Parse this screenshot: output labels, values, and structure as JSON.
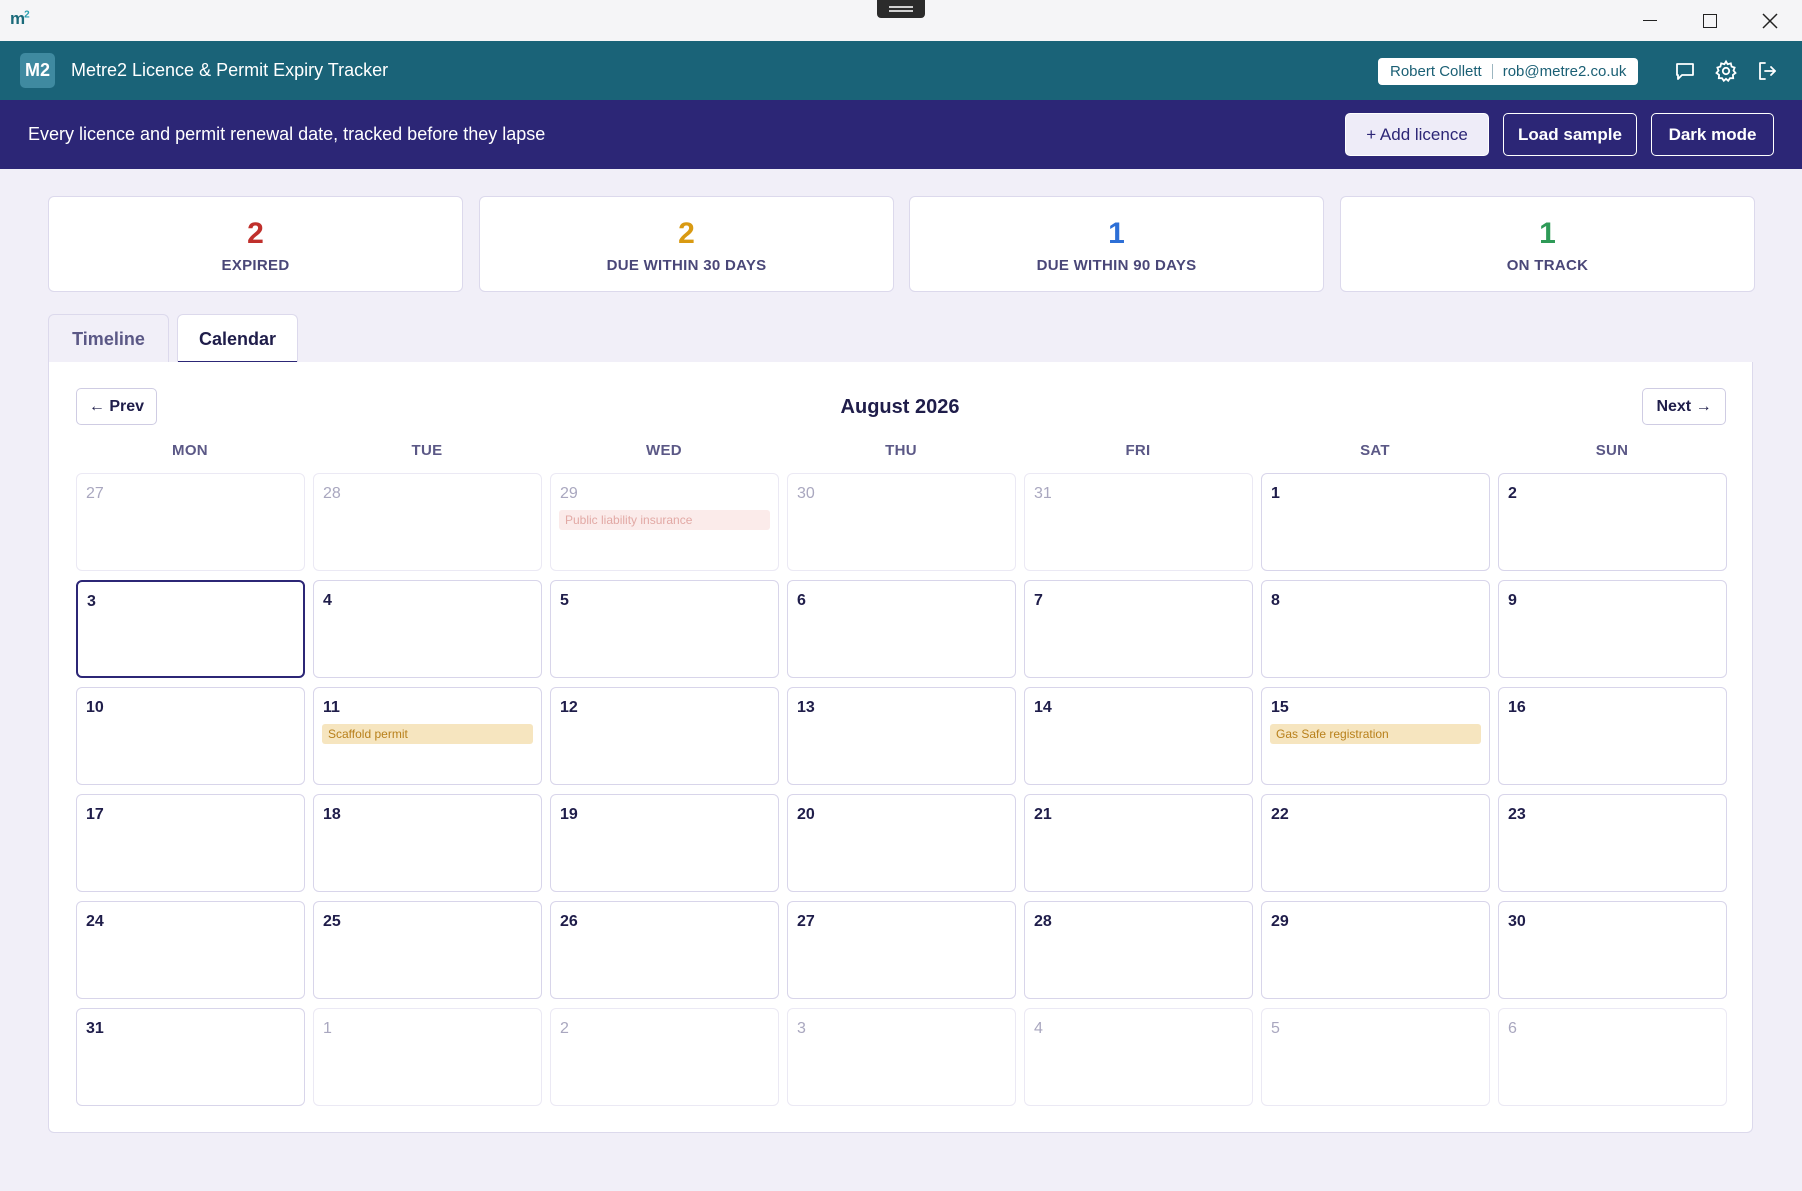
{
  "window": {
    "logo": "m",
    "logo_sup": "2"
  },
  "app": {
    "badge": "M2",
    "title": "Metre2 Licence & Permit Expiry Tracker",
    "user_name": "Robert Collett",
    "user_email": "rob@metre2.co.uk"
  },
  "banner": {
    "tagline": "Every licence and permit renewal date, tracked before they lapse",
    "add_label": "+ Add licence",
    "sample_label": "Load sample",
    "dark_label": "Dark mode"
  },
  "stats": [
    {
      "value": "2",
      "label": "EXPIRED",
      "color": "#c0302c"
    },
    {
      "value": "2",
      "label": "DUE WITHIN 30 DAYS",
      "color": "#d99a12"
    },
    {
      "value": "1",
      "label": "DUE WITHIN 90 DAYS",
      "color": "#2d6fd6"
    },
    {
      "value": "1",
      "label": "ON TRACK",
      "color": "#2e9a57"
    }
  ],
  "tabs": {
    "timeline": "Timeline",
    "calendar": "Calendar",
    "active": "Calendar"
  },
  "calendar": {
    "prev_label": "← Prev",
    "next_label": "Next →",
    "month_label": "August 2026",
    "weekdays": [
      "MON",
      "TUE",
      "WED",
      "THU",
      "FRI",
      "SAT",
      "SUN"
    ],
    "today": 3,
    "weeks": [
      [
        {
          "d": "27",
          "other": true
        },
        {
          "d": "28",
          "other": true
        },
        {
          "d": "29",
          "other": true,
          "event": "Public liability insurance",
          "event_status": "expired"
        },
        {
          "d": "30",
          "other": true
        },
        {
          "d": "31",
          "other": true
        },
        {
          "d": "1"
        },
        {
          "d": "2"
        }
      ],
      [
        {
          "d": "3",
          "today": true
        },
        {
          "d": "4"
        },
        {
          "d": "5"
        },
        {
          "d": "6"
        },
        {
          "d": "7"
        },
        {
          "d": "8"
        },
        {
          "d": "9"
        }
      ],
      [
        {
          "d": "10"
        },
        {
          "d": "11",
          "event": "Scaffold permit",
          "event_status": "due-30"
        },
        {
          "d": "12"
        },
        {
          "d": "13"
        },
        {
          "d": "14"
        },
        {
          "d": "15",
          "event": "Gas Safe registration",
          "event_status": "due-30"
        },
        {
          "d": "16"
        }
      ],
      [
        {
          "d": "17"
        },
        {
          "d": "18"
        },
        {
          "d": "19"
        },
        {
          "d": "20"
        },
        {
          "d": "21"
        },
        {
          "d": "22"
        },
        {
          "d": "23"
        }
      ],
      [
        {
          "d": "24"
        },
        {
          "d": "25"
        },
        {
          "d": "26"
        },
        {
          "d": "27"
        },
        {
          "d": "28"
        },
        {
          "d": "29"
        },
        {
          "d": "30"
        }
      ],
      [
        {
          "d": "31"
        },
        {
          "d": "1",
          "other": true
        },
        {
          "d": "2",
          "other": true
        },
        {
          "d": "3",
          "other": true
        },
        {
          "d": "4",
          "other": true
        },
        {
          "d": "5",
          "other": true
        },
        {
          "d": "6",
          "other": true
        }
      ]
    ]
  }
}
